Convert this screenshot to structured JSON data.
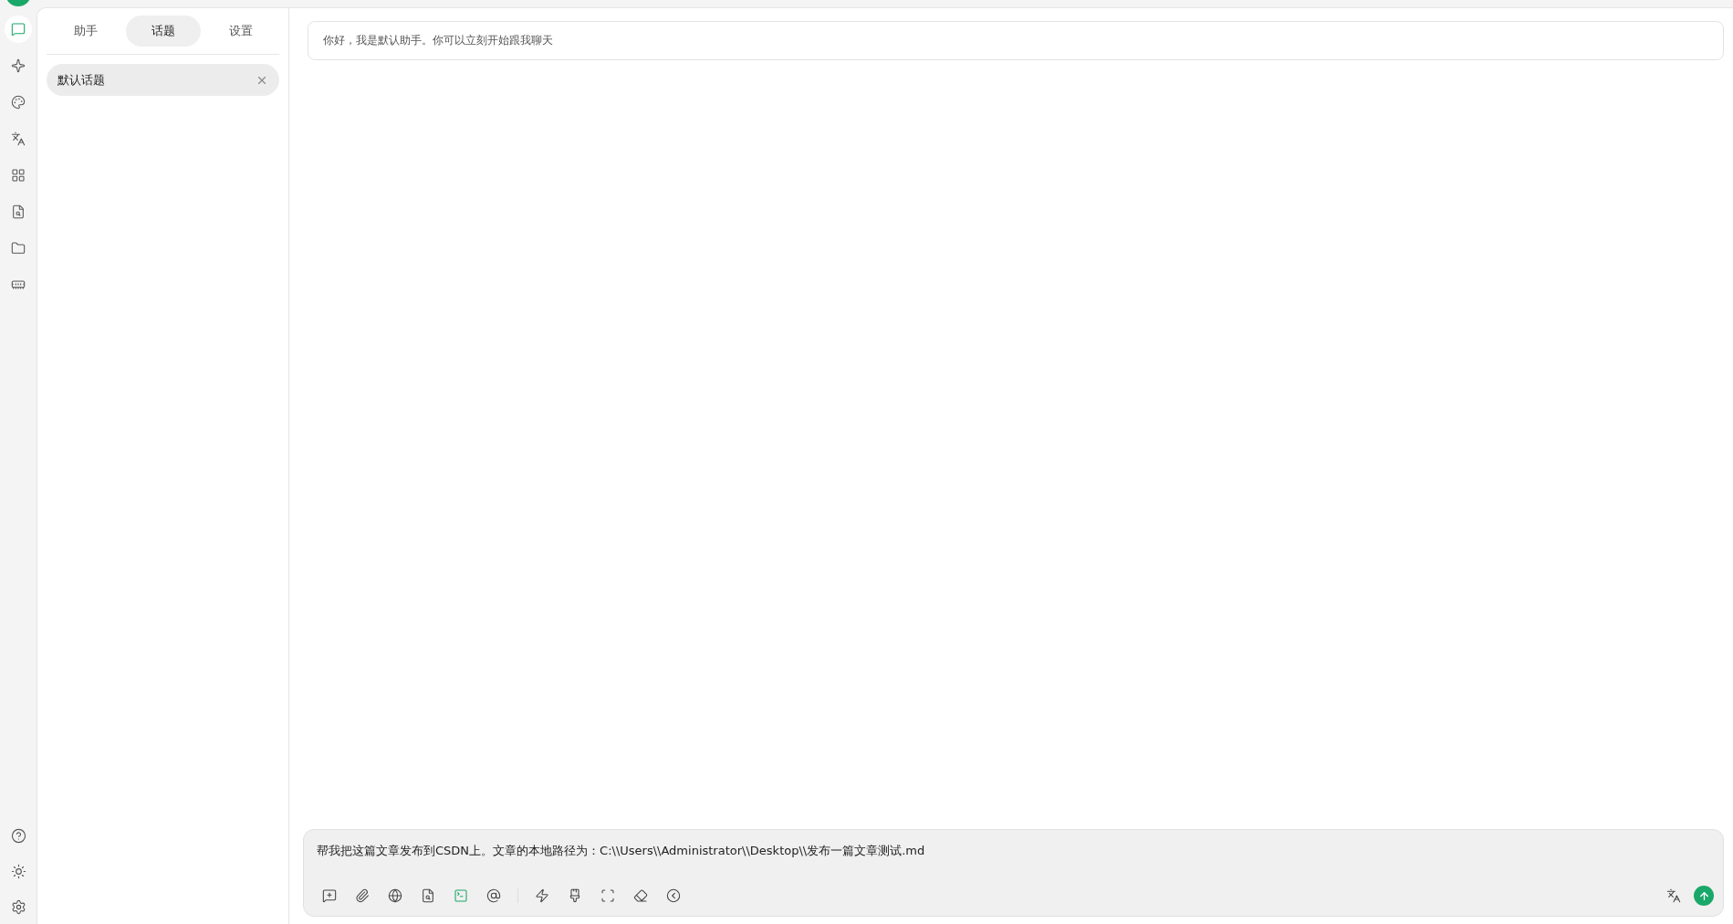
{
  "rail": {
    "items": [
      {
        "selected": true
      },
      {
        "selected": false
      },
      {
        "selected": false
      },
      {
        "selected": false
      },
      {
        "selected": false
      },
      {
        "selected": false
      },
      {
        "selected": false
      },
      {
        "selected": false
      }
    ]
  },
  "tabs": [
    {
      "label": "助手",
      "selected": false
    },
    {
      "label": "话题",
      "selected": true
    },
    {
      "label": "设置",
      "selected": false
    }
  ],
  "topics": [
    {
      "label": "默认话题",
      "selected": true
    }
  ],
  "message": "你好，我是默认助手。你可以立刻开始跟我聊天",
  "composer": {
    "value": "帮我把这篇文章发布到CSDN上。文章的本地路径为：C:\\\\Users\\\\Administrator\\\\Desktop\\\\发布一篇文章测试.md",
    "tools": [
      {
        "on": false
      },
      {
        "on": false
      },
      {
        "on": false
      },
      {
        "on": false
      },
      {
        "on": true
      },
      {
        "on": false
      },
      {
        "on": false
      },
      {
        "on": false
      },
      {
        "on": false
      },
      {
        "on": false
      },
      {
        "on": false
      }
    ]
  }
}
